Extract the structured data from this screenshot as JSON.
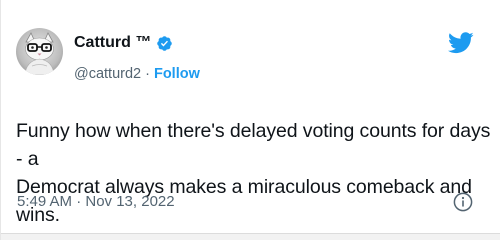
{
  "tweet": {
    "author": {
      "display_name": "Catturd ™",
      "handle": "@catturd2",
      "separator": "·",
      "follow_label": "Follow",
      "verified": true
    },
    "text": "Funny how when there's delayed voting counts for days - a\nDemocrat always makes a miraculous comeback and wins.",
    "timestamp": "5:49 AM · Nov 13, 2022",
    "icons": {
      "platform": "twitter-bird-icon",
      "info": "info-icon",
      "verified": "verified-badge-icon"
    }
  },
  "colors": {
    "accent": "#1d9bf0",
    "text": "#0f1419",
    "secondary": "#536471"
  }
}
